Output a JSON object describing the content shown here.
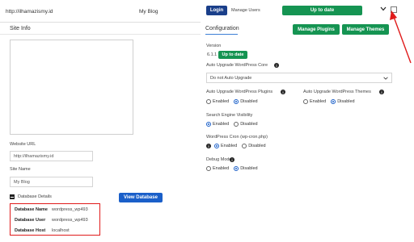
{
  "header": {
    "site_url": "http://ilhamazismy.id",
    "site_title": "My Blog",
    "login_label": "Login",
    "manage_users_label": "Manage Users",
    "up_to_date_label": "Up to date"
  },
  "site_info": {
    "title": "Site Info",
    "website_url_label": "Website URL",
    "website_url_value": "http://ilhamazismy.id",
    "site_name_label": "Site Name",
    "site_name_value": "My Blog",
    "db_details_label": "Database Details",
    "view_database_label": "View Database",
    "db": [
      {
        "key": "Database Name",
        "value": "wordpress_wp493"
      },
      {
        "key": "Database User",
        "value": "wordpress_wp493"
      },
      {
        "key": "Database Host",
        "value": "localhost"
      }
    ]
  },
  "configuration": {
    "title": "Configuration",
    "manage_plugins_label": "Manage Plugins",
    "manage_themes_label": "Manage Themes",
    "version_label": "Version",
    "version_value": "6.1.1",
    "version_status": "Up to date",
    "auto_upgrade_core_label": "Auto Upgrade WordPress Core",
    "auto_upgrade_core_value": "Do not Auto Upgrade",
    "auto_upgrade_plugins_label": "Auto Upgrade WordPress Plugins",
    "auto_upgrade_themes_label": "Auto Upgrade WordPress Themes",
    "search_visibility_label": "Search Engine Visibility",
    "cron_label": "WordPress Cron (wp-cron.php)",
    "debug_label": "Debug Mode",
    "enabled_label": "Enabled",
    "disabled_label": "Disabled",
    "auto_upgrade_plugins_selected": "Disabled",
    "auto_upgrade_themes_selected": "Disabled",
    "search_visibility_selected": "Enabled",
    "cron_selected": "Enabled",
    "debug_selected": "Disabled"
  },
  "icons": {
    "chevron": "chevron-down-icon",
    "info": "info-icon",
    "collapse": "minus-square-icon",
    "annotation": "red-arrow-icon"
  },
  "colors": {
    "primary_blue": "#1a3f8a",
    "button_blue": "#1a5fc9",
    "success_green": "#159452",
    "highlight_red": "#e01b1b"
  }
}
